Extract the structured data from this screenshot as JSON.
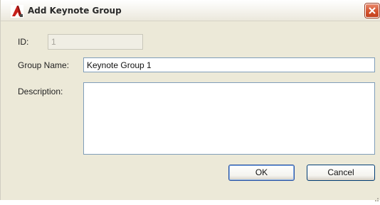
{
  "window": {
    "title": "Add Keynote Group",
    "icon": "autodesk-red-a-icon",
    "close_icon": "close-x-icon"
  },
  "form": {
    "id_label": "ID:",
    "id_value": "1",
    "group_name_label": "Group Name:",
    "group_name_value": "Keynote Group 1",
    "description_label": "Description:",
    "description_value": ""
  },
  "buttons": {
    "ok_label": "OK",
    "cancel_label": "Cancel"
  },
  "colors": {
    "dialog_bg": "#ece9d8",
    "close_button": "#d4532e",
    "input_border": "#7f9db9",
    "default_button_border": "#2a52a0"
  }
}
